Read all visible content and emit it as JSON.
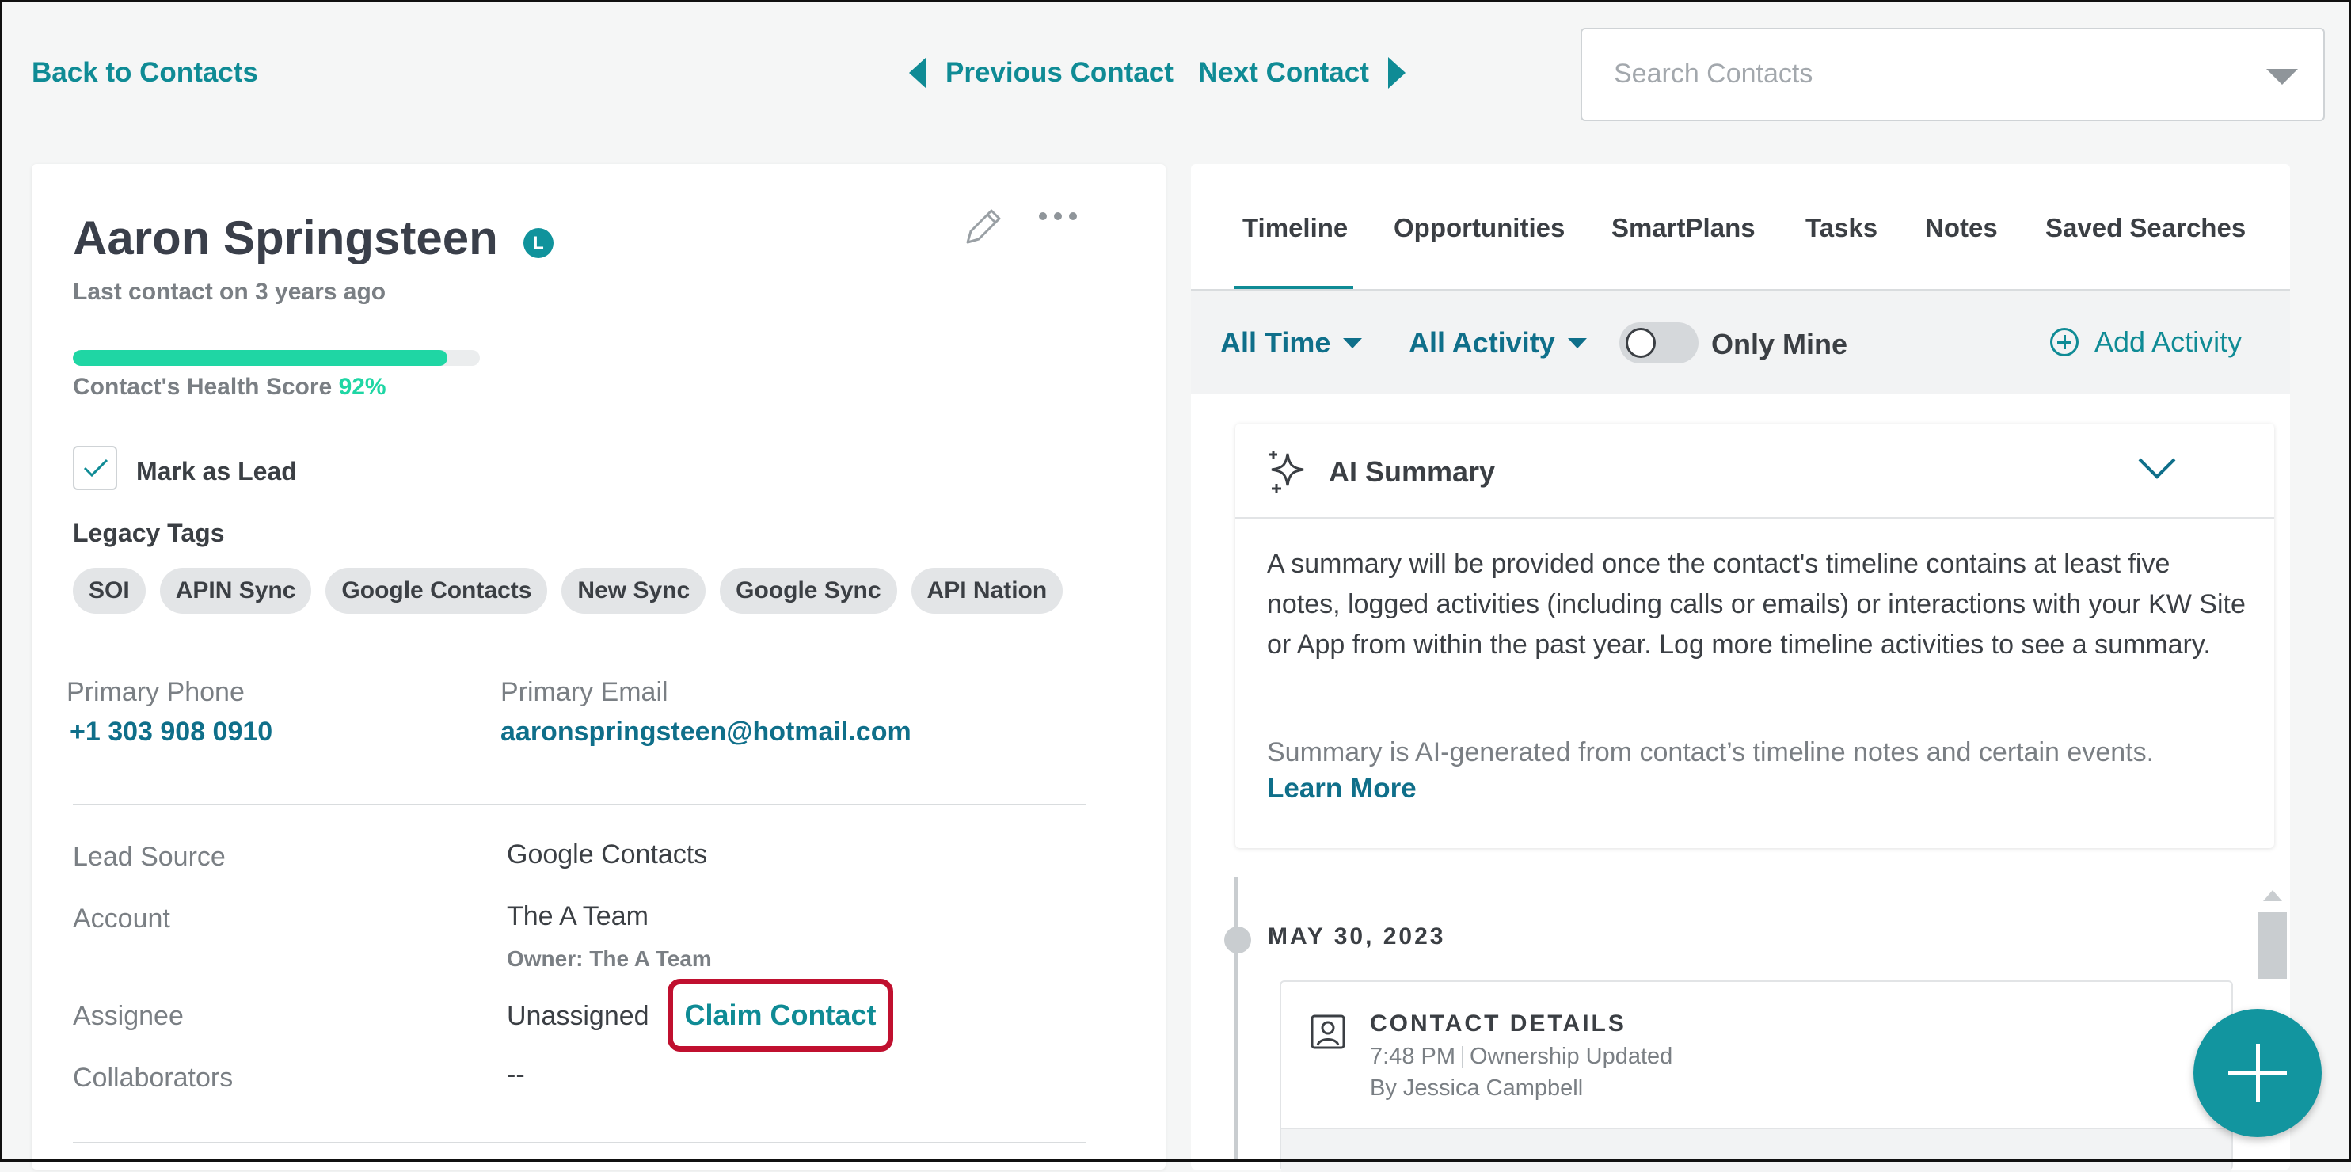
{
  "nav": {
    "back": "Back to Contacts",
    "previous": "Previous Contact",
    "next": "Next Contact",
    "search_placeholder": "Search Contacts"
  },
  "contact": {
    "name": "Aaron Springsteen",
    "badge": "L",
    "last_contact": "Last contact on 3 years ago",
    "health_label": "Contact's Health Score",
    "health_pct": "92%",
    "health_value": 0.92,
    "mark_as_lead": "Mark as Lead",
    "mark_as_lead_checked": true,
    "legacy_tags_label": "Legacy Tags",
    "tags": [
      "SOI",
      "APIN Sync",
      "Google Contacts",
      "New Sync",
      "Google Sync",
      "API Nation"
    ],
    "phone_label": "Primary Phone",
    "phone": "+1 303 908 0910",
    "email_label": "Primary Email",
    "email": "aaronspringsteen@hotmail.com",
    "lead_source_label": "Lead Source",
    "lead_source": "Google Contacts",
    "account_label": "Account",
    "account": "The A Team",
    "owner": "Owner: The A Team",
    "assignee_label": "Assignee",
    "assignee": "Unassigned",
    "claim": "Claim Contact",
    "collaborators_label": "Collaborators",
    "collaborators": "--"
  },
  "tabs": [
    "Timeline",
    "Opportunities",
    "SmartPlans",
    "Tasks",
    "Notes",
    "Saved Searches"
  ],
  "filters": {
    "time": "All Time",
    "activity": "All Activity",
    "only_mine": "Only Mine",
    "add_activity": "Add Activity"
  },
  "ai": {
    "title": "AI Summary",
    "text": "A summary will be provided once the contact's timeline contains at least five notes, logged activities (including calls or emails) or interactions with your KW Site or App from within the past year. Log more timeline activities to see a summary.",
    "note": "Summary is AI-generated from contact’s timeline notes and certain events.",
    "learn_more": "Learn More"
  },
  "timeline": {
    "date": "MAY 30, 2023",
    "entry_title": "CONTACT DETAILS",
    "time": "7:48 PM",
    "event": "Ownership Updated",
    "by": "By Jessica Campbell"
  },
  "colors": {
    "accent": "#0f8b95",
    "health": "#1fd6a4",
    "highlight": "#c0102f"
  }
}
